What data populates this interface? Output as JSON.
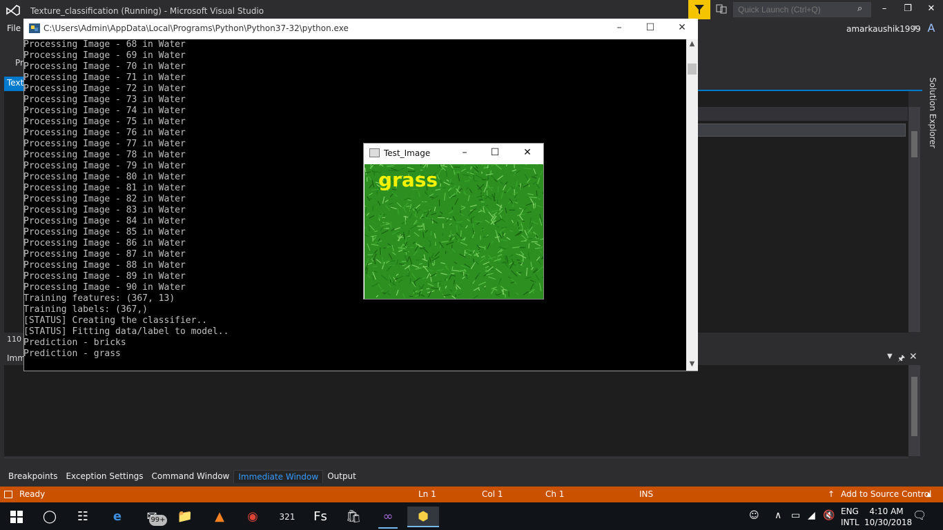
{
  "vs": {
    "title": "Texture_classification (Running) - Microsoft Visual Studio",
    "quick_launch_placeholder": "Quick Launch (Ctrl+Q)",
    "menu_file": "File",
    "user_name": "amarkaushik1999",
    "user_avatar_letter": "A",
    "project_label_fragment": "Pr",
    "doc_tab_fragment": "Text",
    "zoom": "110",
    "solution_explorer": "Solution Explorer",
    "immediate_title_fragment": "Imm",
    "tool_tabs": [
      {
        "label": "Breakpoints",
        "active": false
      },
      {
        "label": "Exception Settings",
        "active": false
      },
      {
        "label": "Command Window",
        "active": false
      },
      {
        "label": "Immediate Window",
        "active": true
      },
      {
        "label": "Output",
        "active": false
      }
    ],
    "status": {
      "ready": "Ready",
      "ln": "Ln 1",
      "col": "Col 1",
      "ch": "Ch 1",
      "ins": "INS",
      "source_control": "Add to Source Control"
    },
    "colors": {
      "accent": "#007acc",
      "status_bar": "#ca5100",
      "filter": "#f4c400"
    }
  },
  "python_console": {
    "title": "C:\\Users\\Admin\\AppData\\Local\\Programs\\Python\\Python37-32\\python.exe",
    "lines": [
      "Processing Image - 68 in Water",
      "Processing Image - 69 in Water",
      "Processing Image - 70 in Water",
      "Processing Image - 71 in Water",
      "Processing Image - 72 in Water",
      "Processing Image - 73 in Water",
      "Processing Image - 74 in Water",
      "Processing Image - 75 in Water",
      "Processing Image - 76 in Water",
      "Processing Image - 77 in Water",
      "Processing Image - 78 in Water",
      "Processing Image - 79 in Water",
      "Processing Image - 80 in Water",
      "Processing Image - 81 in Water",
      "Processing Image - 82 in Water",
      "Processing Image - 83 in Water",
      "Processing Image - 84 in Water",
      "Processing Image - 85 in Water",
      "Processing Image - 86 in Water",
      "Processing Image - 87 in Water",
      "Processing Image - 88 in Water",
      "Processing Image - 89 in Water",
      "Processing Image - 90 in Water",
      "Training features: (367, 13)",
      "Training labels: (367,)",
      "[STATUS] Creating the classifier..",
      "[STATUS] Fitting data/label to model..",
      "Prediction - bricks",
      "Prediction - grass"
    ]
  },
  "test_image": {
    "title": "Test_Image",
    "label": "grass"
  },
  "taskbar": {
    "mail_badge": "99+",
    "calendar_text": "321",
    "fs_text": "Fs",
    "lang_line1": "ENG",
    "lang_line2": "INTL",
    "time": "4:10 AM",
    "date": "10/30/2018"
  }
}
